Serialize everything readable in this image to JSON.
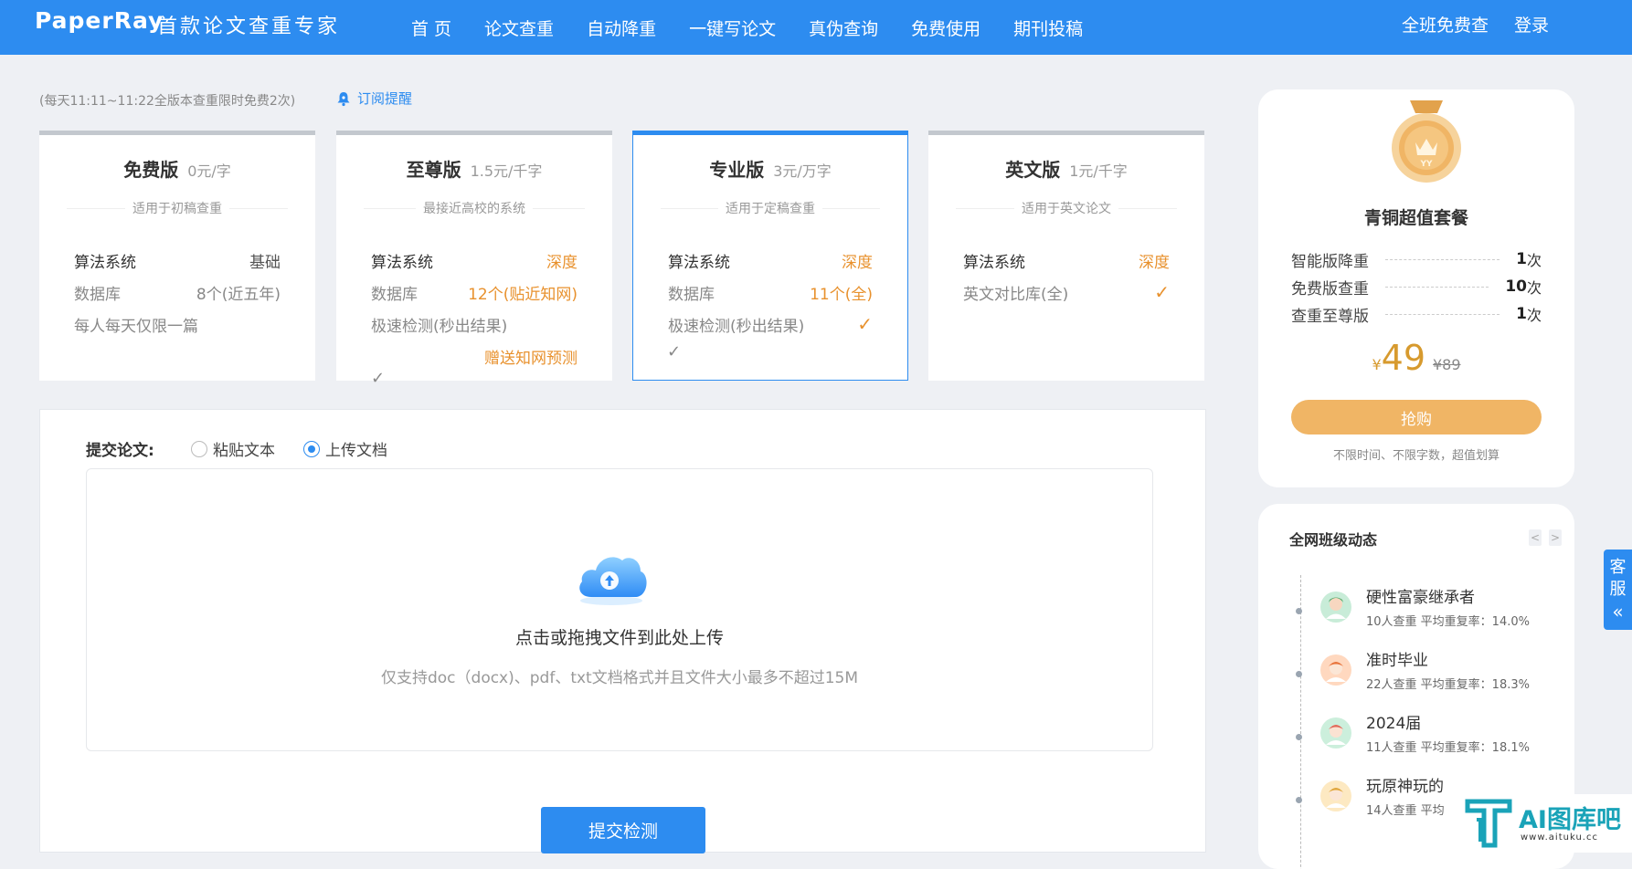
{
  "header": {
    "logo": "PaperRay",
    "slogan": "首款论文查重专家",
    "nav": [
      "首 页",
      "论文查重",
      "自动降重",
      "一键写论文",
      "真伪查询",
      "免费使用",
      "期刊投稿"
    ],
    "right": [
      "全班免费查",
      "登录"
    ]
  },
  "notice": {
    "text": "(每天11:11~11:22全版本查重限时免费2次)",
    "subscribe": "订阅提醒"
  },
  "plans": [
    {
      "name": "免费版",
      "price": "0元/字",
      "desc": "适用于初稿查重",
      "features": [
        {
          "label": "算法系统",
          "value": "基础"
        },
        {
          "label": "数据库",
          "value": "8个(近五年)"
        },
        {
          "label": "每人每天仅限一篇",
          "value": ""
        }
      ]
    },
    {
      "name": "至尊版",
      "price": "1.5元/千字",
      "desc": "最接近高校的系统",
      "features": [
        {
          "label": "算法系统",
          "value": "深度"
        },
        {
          "label": "数据库",
          "value": "12个(贴近知网)"
        },
        {
          "label": "极速检测(秒出结果)",
          "value": ""
        },
        {
          "label": "",
          "value": "赠送知网预测"
        }
      ],
      "check": "✓"
    },
    {
      "name": "专业版",
      "price": "3元/万字",
      "desc": "适用于定稿查重",
      "features": [
        {
          "label": "算法系统",
          "value": "深度"
        },
        {
          "label": "数据库",
          "value": "11个(全)"
        },
        {
          "label": "极速检测(秒出结果)",
          "value": "✓"
        }
      ],
      "check": "✓"
    },
    {
      "name": "英文版",
      "price": "1元/千字",
      "desc": "适用于英文论文",
      "features": [
        {
          "label": "算法系统",
          "value": "深度"
        },
        {
          "label": "英文对比库(全)",
          "value": "✓"
        }
      ]
    }
  ],
  "submit": {
    "label": "提交论文:",
    "options": [
      "粘贴文本",
      "上传文档"
    ],
    "selected": "上传文档",
    "upload_main": "点击或拖拽文件到此处上传",
    "upload_hint": "仅支持doc（docx)、pdf、txt文档格式并且文件大小最多不超过15M",
    "button": "提交检测"
  },
  "package": {
    "title": "青铜超值套餐",
    "items": [
      {
        "name": "智能版降重",
        "count": "1",
        "unit": "次"
      },
      {
        "name": "免费版查重",
        "count": "10",
        "unit": "次"
      },
      {
        "name": "查重至尊版",
        "count": "1",
        "unit": "次"
      }
    ],
    "currency": "¥",
    "price": "49",
    "old_price": "¥89",
    "button": "抢购",
    "note": "不限时间、不限字数，超值划算"
  },
  "dynamics": {
    "title": "全网班级动态",
    "items": [
      {
        "name": "硬性富豪继承者",
        "stat": "10人查重  平均重复率：14.0%"
      },
      {
        "name": "准时毕业",
        "stat": "22人查重  平均重复率：18.3%"
      },
      {
        "name": "2024届",
        "stat": "11人查重  平均重复率：18.1%"
      },
      {
        "name": "玩原神玩的",
        "stat": "14人查重  平均"
      }
    ]
  },
  "service": {
    "label": "客服",
    "arrow": "«"
  },
  "watermark": {
    "text": "AI图库吧",
    "url": "www.aituku.cc"
  },
  "colors": {
    "primary": "#2d8cf0",
    "accent": "#e8912d",
    "gold": "#f0b565"
  }
}
